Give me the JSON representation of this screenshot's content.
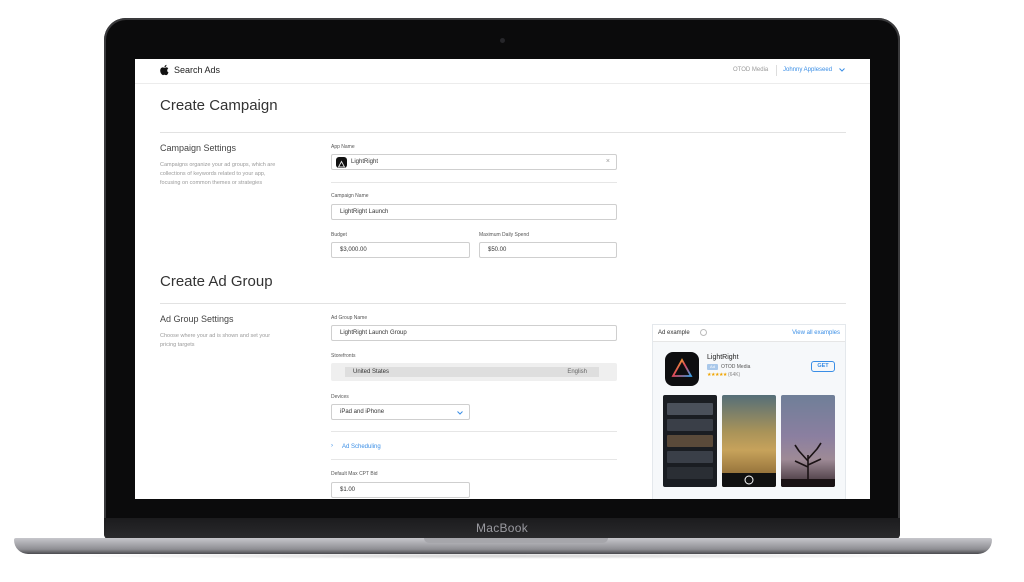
{
  "device": {
    "brand": "MacBook"
  },
  "topbar": {
    "app_title": "Search Ads",
    "org": "OTOD Media",
    "user": "Johnny Appleseed"
  },
  "campaign": {
    "heading": "Create Campaign",
    "settings_title": "Campaign Settings",
    "settings_desc": "Campaigns organize your ad groups, which are collections of keywords related to your app, focusing on common themes or strategies",
    "app_name_label": "App Name",
    "app_name_value": "LightRight",
    "campaign_name_label": "Campaign Name",
    "campaign_name_value": "LightRight Launch",
    "budget_label": "Budget",
    "budget_value": "$3,000.00",
    "daily_label": "Maximum Daily Spend",
    "daily_value": "$50.00"
  },
  "ad_group": {
    "heading": "Create Ad Group",
    "settings_title": "Ad Group Settings",
    "settings_desc": "Choose where your ad is shown and set your pricing targets",
    "name_label": "Ad Group Name",
    "name_value": "LightRight Launch Group",
    "storefronts_label": "Storefronts",
    "storefront_country": "United States",
    "storefront_language": "English",
    "devices_label": "Devices",
    "devices_value": "iPad and iPhone",
    "scheduling_link": "Ad Scheduling",
    "cpt_label": "Default Max CPT Bid",
    "cpt_value": "$1.00"
  },
  "ad_example": {
    "title": "Ad example",
    "view_all": "View all examples",
    "app_name": "LightRight",
    "badge": "Ad",
    "developer": "OTOD Media",
    "stars": "★★★★★",
    "rating_count": "(64K)",
    "get_label": "GET"
  },
  "colors": {
    "accent": "#3a8ee6",
    "bezel": "#0b0b0c"
  }
}
